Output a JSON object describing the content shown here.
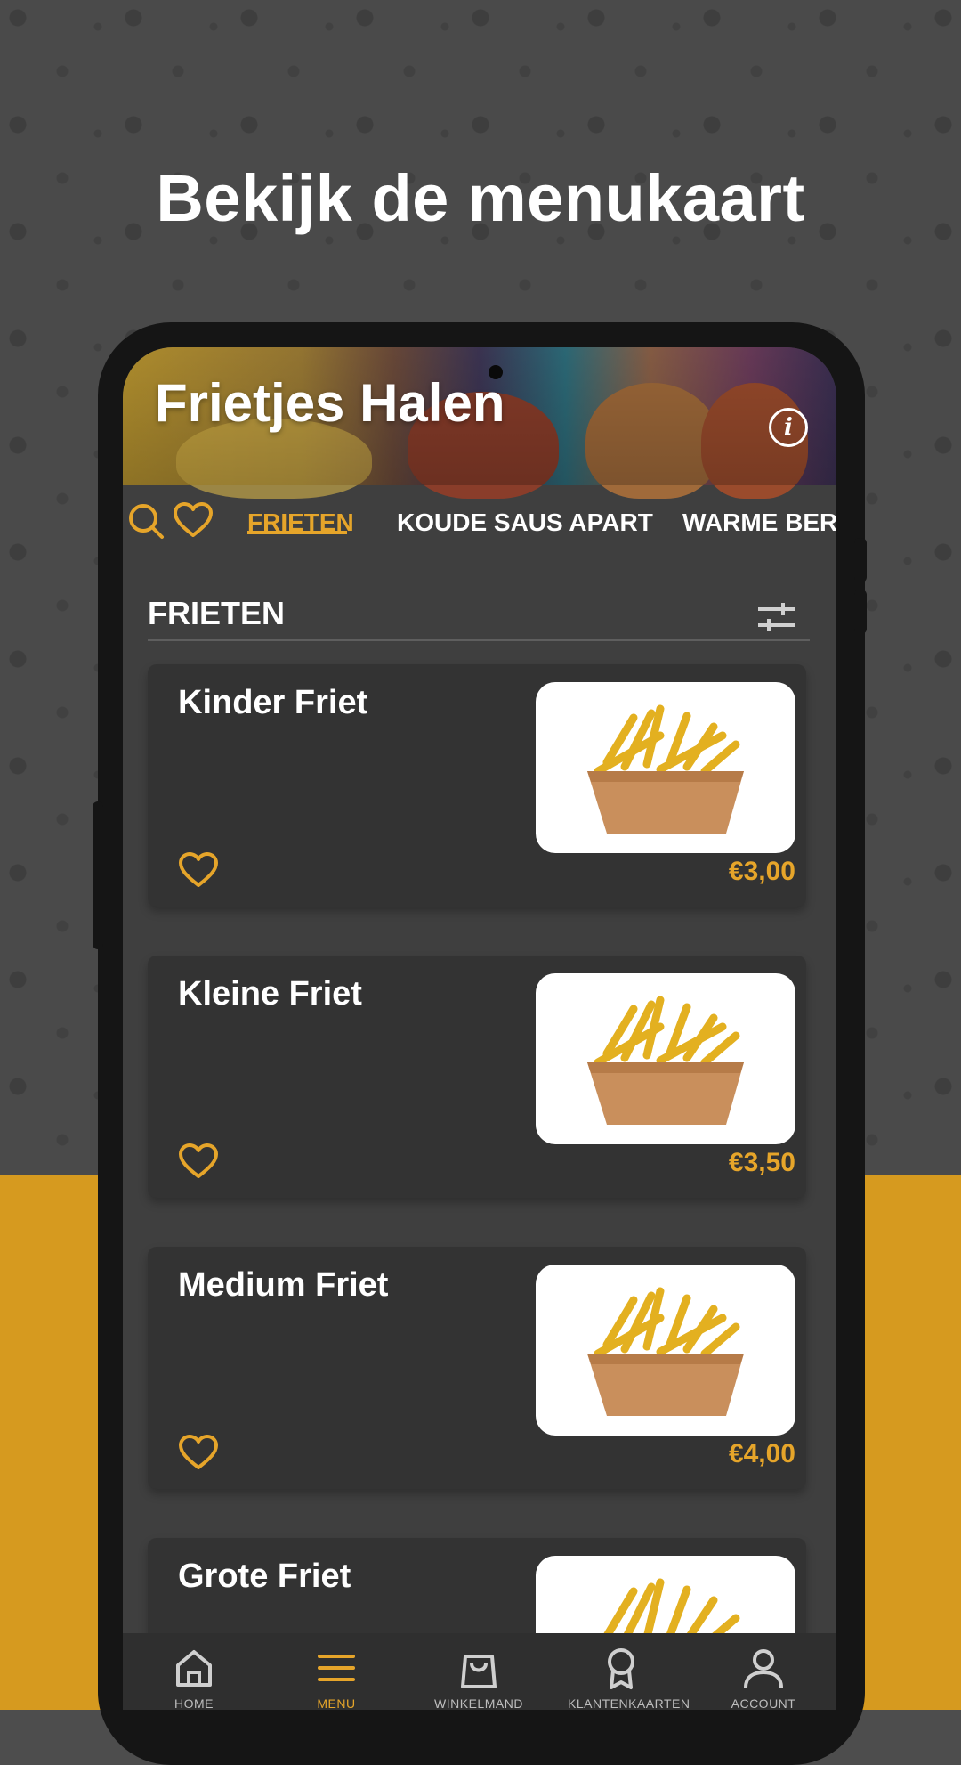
{
  "headline": "Bekijk de menukaart",
  "restaurant": {
    "title": "Frietjes Halen",
    "info_icon_text": "i"
  },
  "tabs": [
    {
      "label": "FRIETEN",
      "active": true
    },
    {
      "label": "KOUDE SAUS APART",
      "active": false
    },
    {
      "label": "WARME BERI",
      "active": false
    }
  ],
  "section": {
    "title": "FRIETEN"
  },
  "products": [
    {
      "name": "Kinder Friet",
      "price": "€3,00"
    },
    {
      "name": "Kleine Friet",
      "price": "€3,50"
    },
    {
      "name": "Medium Friet",
      "price": "€4,00"
    },
    {
      "name": "Grote Friet",
      "price": ""
    }
  ],
  "bottom_nav": [
    {
      "label": "HOME",
      "icon": "home-icon",
      "active": false
    },
    {
      "label": "MENU",
      "icon": "menu-icon",
      "active": true
    },
    {
      "label": "WINKELMAND",
      "icon": "bag-icon",
      "active": false
    },
    {
      "label": "KLANTENKAARTEN",
      "icon": "award-icon",
      "active": false
    },
    {
      "label": "ACCOUNT",
      "icon": "user-icon",
      "active": false
    }
  ],
  "colors": {
    "accent": "#e6a52a",
    "background_bottom": "#d69a1f",
    "screen_bg": "#3f3f3f",
    "card_bg": "#333333"
  }
}
